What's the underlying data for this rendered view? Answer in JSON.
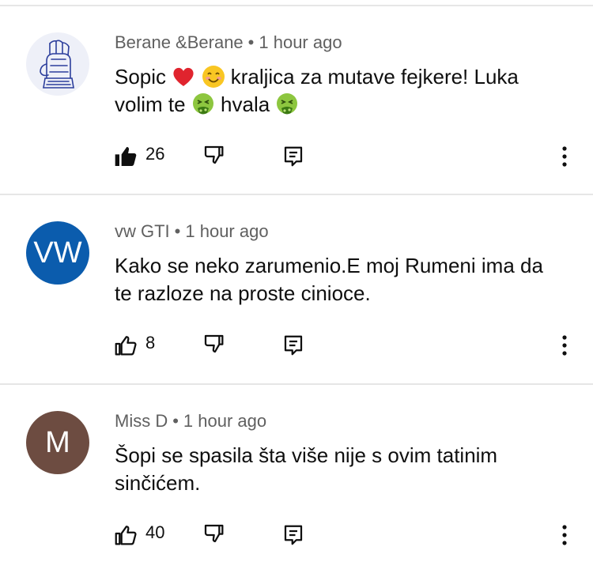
{
  "comments": [
    {
      "author": "Berane &Berane",
      "separator": "•",
      "time": "1 hour ago",
      "avatar_text": "",
      "avatar_color": "#eef0f8",
      "text_parts": [
        "Sopic ",
        " ",
        " kraljica za mutave fejkere! Luka volim te ",
        " hvala ",
        ""
      ],
      "emojis": [
        "red-heart",
        "smiling-face",
        "nauseated-face",
        "nauseated-face"
      ],
      "likes": "26",
      "liked": true
    },
    {
      "author": "vw GTI",
      "separator": "•",
      "time": "1 hour ago",
      "avatar_text": "VW",
      "avatar_color": "#0b5cad",
      "text": "Kako se neko zarumenio.E moj Rumeni ima da te razloze na proste cinioce.",
      "likes": "8",
      "liked": false
    },
    {
      "author": "Miss D",
      "separator": "•",
      "time": "1 hour ago",
      "avatar_text": "M",
      "avatar_color": "#6d4c41",
      "text": "Šopi se spasila šta više nije s ovim tatinim sinčićem.",
      "likes": "40",
      "liked": false
    }
  ],
  "icons": {
    "like": "thumb-up-icon",
    "dislike": "thumb-down-icon",
    "reply": "reply-icon",
    "more": "more-vert-icon"
  }
}
